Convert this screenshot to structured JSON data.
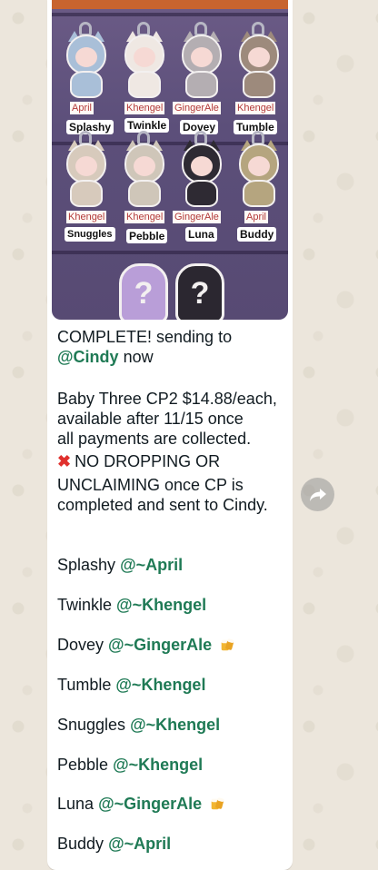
{
  "photo": {
    "charms": [
      {
        "owner": "April",
        "name": "Splashy",
        "color": "#a9bfd8"
      },
      {
        "owner": "Khengel",
        "name": "Twinkle",
        "color": "#f2ebe6"
      },
      {
        "owner": "GingerAle",
        "name": "Dovey",
        "color": "#b4aeb2"
      },
      {
        "owner": "Khengel",
        "name": "Tumble",
        "color": "#9d8a7c"
      },
      {
        "owner": "Khengel",
        "name": "Snuggles",
        "color": "#d7cabc"
      },
      {
        "owner": "Khengel",
        "name": "Pebble",
        "color": "#cfc6b9"
      },
      {
        "owner": "GingerAle",
        "name": "Luna",
        "color": "#2e2a33"
      },
      {
        "owner": "April",
        "name": "Buddy",
        "color": "#b5a57f"
      }
    ],
    "mystery_mark": "?"
  },
  "message": {
    "line1": "COMPLETE! sending to",
    "mention_cindy": "@Cindy",
    "line2_suffix": " now",
    "para2": [
      "Baby Three CP2 $14.88/each,",
      "available after 11/15 once",
      "all payments are collected."
    ],
    "warning_line1": "NO DROPPING OR",
    "warning_line2": "UNCLAIMING once CP is",
    "warning_line3": "completed and sent to Cindy.",
    "assignments": [
      {
        "name": "Splashy",
        "mention": "@~April",
        "emoji": false
      },
      {
        "name": "Twinkle",
        "mention": "@~Khengel",
        "emoji": false
      },
      {
        "name": "Dovey",
        "mention": "@~GingerAle",
        "emoji": true
      },
      {
        "name": "Tumble",
        "mention": "@~Khengel",
        "emoji": false
      },
      {
        "name": "Snuggles",
        "mention": "@~Khengel",
        "emoji": false
      },
      {
        "name": "Pebble",
        "mention": "@~Khengel",
        "emoji": false
      },
      {
        "name": "Luna",
        "mention": "@~GingerAle",
        "emoji": true
      },
      {
        "name": "Buddy",
        "mention": "@~April",
        "emoji": false
      }
    ]
  },
  "icons": {
    "forward": "forward-icon",
    "warning": "cross-mark-icon",
    "beer": "beer-mugs-icon"
  },
  "colors": {
    "mention": "#1f7a55",
    "bubble": "#ffffff",
    "wallpaper": "#efeae2"
  }
}
